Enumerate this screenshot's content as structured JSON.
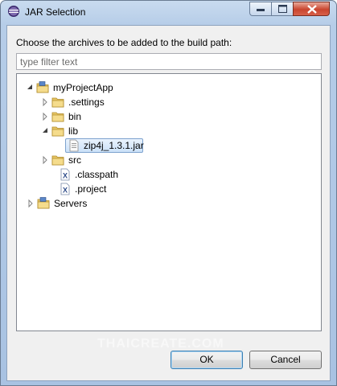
{
  "window": {
    "title": "JAR Selection"
  },
  "dialog": {
    "prompt": "Choose the archives to be added to the build path:",
    "filter": {
      "value": "",
      "placeholder": "type filter text"
    }
  },
  "tree": {
    "project": "myProjectApp",
    "settings": ".settings",
    "bin": "bin",
    "lib": "lib",
    "jar": "zip4j_1.3.1.jar",
    "src": "src",
    "classpath": ".classpath",
    "projectFile": ".project",
    "servers": "Servers",
    "selected": "zip4j_1.3.1.jar"
  },
  "buttons": {
    "ok": "OK",
    "cancel": "Cancel"
  },
  "watermark": "THAICREATE.COM",
  "colors": {
    "selection": "#cbe1f8",
    "folder": "#e8c766",
    "titlebar": "#b6cde8"
  }
}
